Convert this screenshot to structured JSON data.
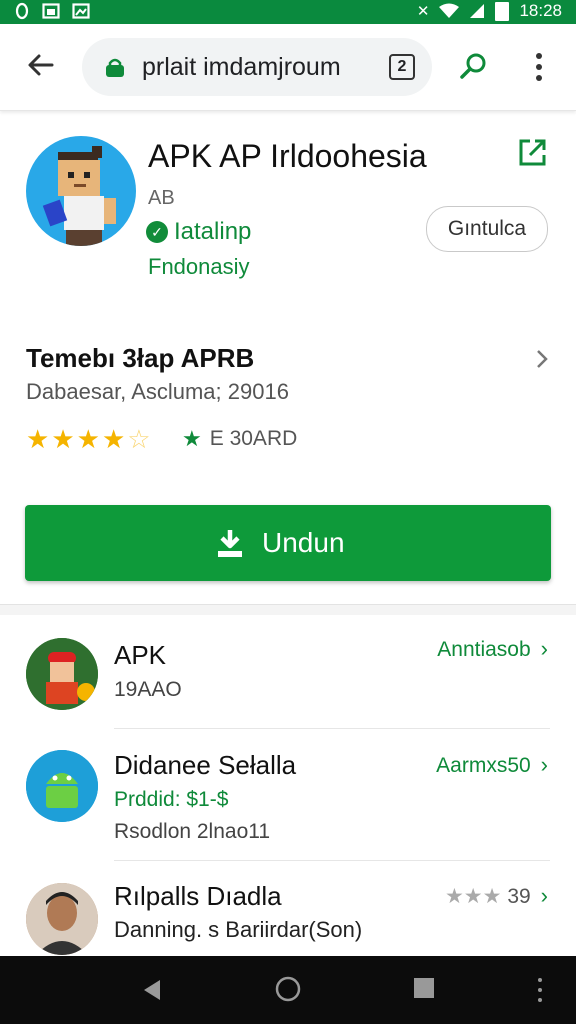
{
  "status_bar": {
    "time": "18:28",
    "icons": [
      "app-notification-icon",
      "photo-icon",
      "mute-icon",
      "wifi-icon",
      "signal-icon",
      "battery-icon"
    ]
  },
  "browser": {
    "url": "prlait imdamjroum",
    "tab_count": "2",
    "icons": [
      "back-arrow-icon",
      "lock-icon",
      "search-icon",
      "more-vert-icon"
    ]
  },
  "app": {
    "title": "APK AP Irldoohesia",
    "developer": "AB",
    "verified_label": "Iatalinp",
    "region": "Fndonasiy",
    "install_chip": "Gıntulca"
  },
  "details": {
    "title": "Temebı 3łap APRB",
    "subtitle": "Dabaesar, Ascluma; 29016",
    "rating_stars": 4.5,
    "award_text": "E 30ARD"
  },
  "download": {
    "label": "Undun"
  },
  "related": [
    {
      "title": "APK",
      "line1": "19AAO",
      "line2": "",
      "action": "Anntiasob",
      "icon": "gamer-avatar-icon"
    },
    {
      "title": "Didanee Sełalla",
      "line1": "Prddid: $1-$",
      "line2": "Rsodlon 2lnao11",
      "action": "Aarmxs50",
      "icon": "android-robot-icon"
    },
    {
      "title": "Rılpalls Dıadla",
      "line1": "Danning. s Bariirdar(Son)",
      "line2": "",
      "action": "39",
      "icon": "person-avatar-icon"
    }
  ],
  "colors": {
    "status_bar": "#0a8a3e",
    "accent_green": "#0f8a3a",
    "download_button": "#0e9a3a",
    "star": "#f5b400"
  }
}
